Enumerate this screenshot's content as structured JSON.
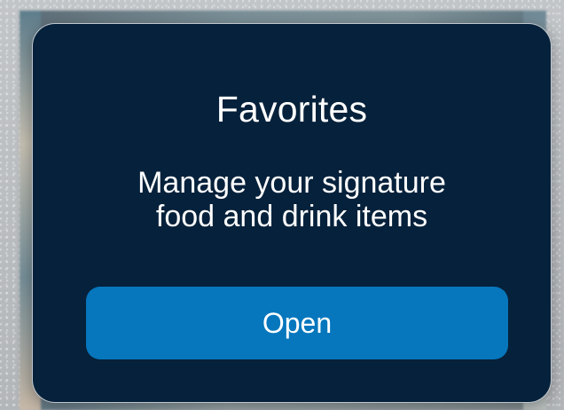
{
  "card": {
    "title": "Favorites",
    "description_line1": "Manage your signature",
    "description_line2": "food and drink items",
    "open_label": "Open"
  },
  "colors": {
    "card_background": "#06213b",
    "button_background": "#0677bd",
    "text": "#ffffff"
  }
}
